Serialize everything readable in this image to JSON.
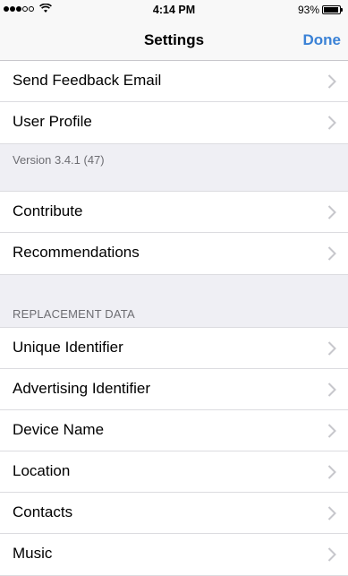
{
  "status": {
    "time": "4:14 PM",
    "battery_text": "93%",
    "battery_level": 0.93
  },
  "nav": {
    "title": "Settings",
    "done_label": "Done",
    "accent_color": "#3b82d6"
  },
  "group1": {
    "items": [
      {
        "label": "Send Feedback Email"
      },
      {
        "label": "User Profile"
      }
    ]
  },
  "version": "Version 3.4.1 (47)",
  "group2": {
    "items": [
      {
        "label": "Contribute"
      },
      {
        "label": "Recommendations"
      }
    ]
  },
  "replacement": {
    "header": "REPLACEMENT DATA",
    "items": [
      {
        "label": "Unique Identifier"
      },
      {
        "label": "Advertising Identifier"
      },
      {
        "label": "Device Name"
      },
      {
        "label": "Location"
      },
      {
        "label": "Contacts"
      },
      {
        "label": "Music"
      }
    ]
  },
  "icons": {
    "signal": "signal-dots-icon",
    "wifi": "wifi-icon",
    "battery": "battery-icon",
    "chevron": "chevron-right-icon"
  }
}
